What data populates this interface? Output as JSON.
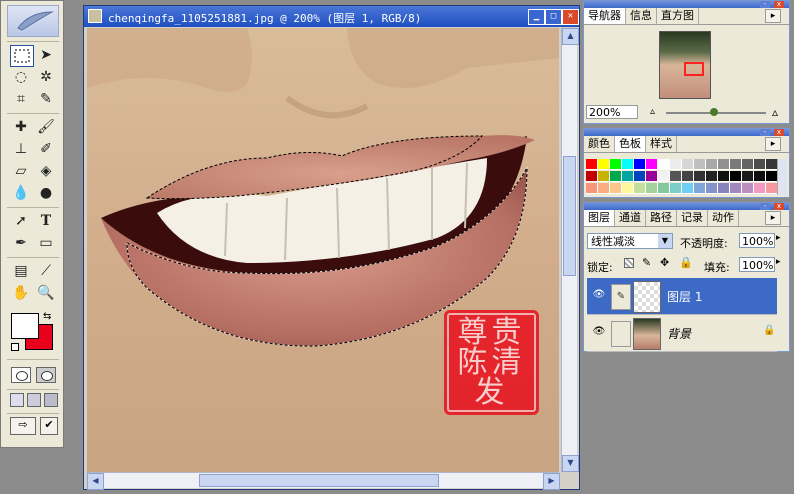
{
  "document": {
    "title": "chenqingfa_1105251881.jpg @ 200% (图层 1, RGB/8)",
    "stamp_text": "尊贵陈清发"
  },
  "navigator": {
    "tabs": [
      "导航器",
      "信息",
      "直方图"
    ],
    "zoom": "200%"
  },
  "color_panel": {
    "tabs": [
      "颜色",
      "色板",
      "样式"
    ],
    "swatches_row1": [
      "#ff0000",
      "#ffff00",
      "#00ff00",
      "#00ffff",
      "#0000ff",
      "#ff00ff",
      "#ffffff",
      "#ececec",
      "#d6d6d6",
      "#bfbfbf",
      "#a8a8a8",
      "#919191",
      "#7a7a7a",
      "#636363",
      "#4d4d4d",
      "#363636"
    ],
    "swatches_row2": [
      "#c30000",
      "#c8b400",
      "#00a84e",
      "#00a3a3",
      "#0044c0",
      "#9a009a",
      "#f2f2f2",
      "#555555",
      "#444444",
      "#333333",
      "#222222",
      "#111111",
      "#000000",
      "#1a1a1a",
      "#0d0d0d",
      "#000000"
    ],
    "swatches_row3": [
      "#f7977a",
      "#f9ad81",
      "#fdc68a",
      "#fff79a",
      "#c4df9b",
      "#a2d39c",
      "#82ca9d",
      "#7bcdc8",
      "#6ecff6",
      "#7ea7d8",
      "#8493ca",
      "#8882be",
      "#a187be",
      "#bc8dbf",
      "#f49ac2",
      "#f6989d"
    ]
  },
  "layers_panel": {
    "tabs": [
      "图层",
      "通道",
      "路径",
      "记录",
      "动作"
    ],
    "blend_mode": "线性减淡",
    "opacity_label": "不透明度:",
    "opacity_value": "100%",
    "lock_label": "锁定:",
    "fill_label": "填充:",
    "fill_value": "100%",
    "layers": [
      {
        "name": "图层 1",
        "selected": true
      },
      {
        "name": "背景",
        "selected": false
      }
    ]
  },
  "toolbox": {
    "foreground_color": "#ffffff",
    "background_color": "#e8001c",
    "tools": [
      "marquee-tool",
      "move-tool",
      "lasso-tool",
      "magic-wand-tool",
      "crop-tool",
      "slice-tool",
      "healing-brush-tool",
      "brush-tool",
      "clone-stamp-tool",
      "history-brush-tool",
      "eraser-tool",
      "paint-bucket-tool",
      "blur-tool",
      "dodge-tool",
      "path-select-tool",
      "type-tool",
      "pen-tool",
      "rectangle-tool",
      "notes-tool",
      "eyedropper-tool",
      "hand-tool",
      "zoom-tool"
    ],
    "text_tool_glyph": "T"
  },
  "colors": {
    "title_bar": "#2456c8",
    "selected_layer": "#3d6ac4",
    "stamp_red": "#e8131f"
  }
}
